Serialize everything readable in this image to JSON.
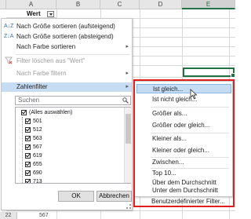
{
  "columns": [
    "A",
    "B",
    "C",
    "D",
    "E"
  ],
  "selected_column": "E",
  "header_cell": "Wert",
  "menu": {
    "items": [
      {
        "icon": "A↓Z",
        "label": "Nach Größe sortieren (aufsteigend)"
      },
      {
        "icon": "Z↓A",
        "label": "Nach Größe sortieren (absteigend)"
      },
      {
        "label": "Nach Farbe sortieren"
      },
      {
        "label": "Filter löschen aus \"Wert\""
      },
      {
        "label": "Nach Farbe filtern"
      },
      {
        "label": "Zahlenfilter"
      }
    ],
    "search_placeholder": "Suchen",
    "list": [
      "(Alles auswählen)",
      "501",
      "512",
      "563",
      "567",
      "619",
      "655",
      "690",
      "713"
    ],
    "ok_label": "OK",
    "cancel_label": "Abbrechen"
  },
  "submenu": {
    "items": [
      "Ist gleich...",
      "Ist nicht gleich...",
      "Größer als...",
      "Größer oder gleich...",
      "Kleiner als...",
      "Kleiner oder gleich...",
      "Zwischen...",
      "Top 10...",
      "Über dem Durchschnitt",
      "Unter dem Durchschnitt",
      "Benutzerdefinierter Filter..."
    ]
  },
  "bottom_row": {
    "number": "22",
    "value": "567"
  },
  "colors": {
    "accent": "#217346",
    "highlight": "#c5dcf3",
    "outline": "#e02020"
  }
}
